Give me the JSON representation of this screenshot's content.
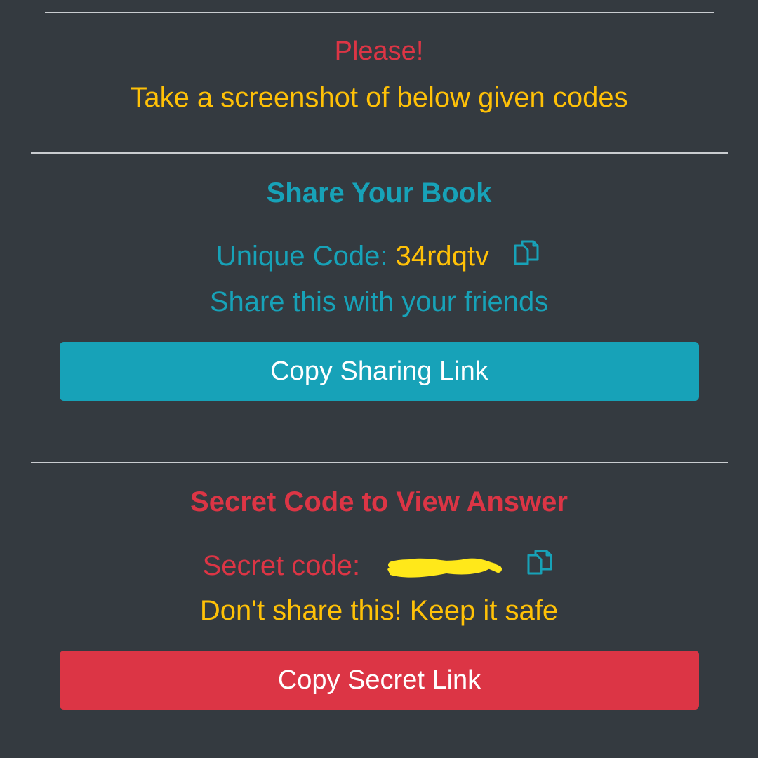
{
  "notice": {
    "alert": "Please!",
    "instruction": "Take a screenshot of below given codes"
  },
  "share_section": {
    "title": "Share Your Book",
    "code_label": "Unique Code: ",
    "code_value": "34rdqtv",
    "hint": "Share this with your friends",
    "button_label": "Copy Sharing Link",
    "copy_icon": "copy-icon"
  },
  "secret_section": {
    "title": "Secret Code to View Answer",
    "code_label": "Secret code:",
    "code_value_redacted": true,
    "warning": "Don't share this! Keep it safe",
    "button_label": "Copy Secret Link",
    "copy_icon": "copy-icon"
  },
  "colors": {
    "background": "#343a40",
    "info": "#17a2b8",
    "danger": "#dc3545",
    "warning": "#ffc107",
    "divider": "#c9ccd0"
  }
}
